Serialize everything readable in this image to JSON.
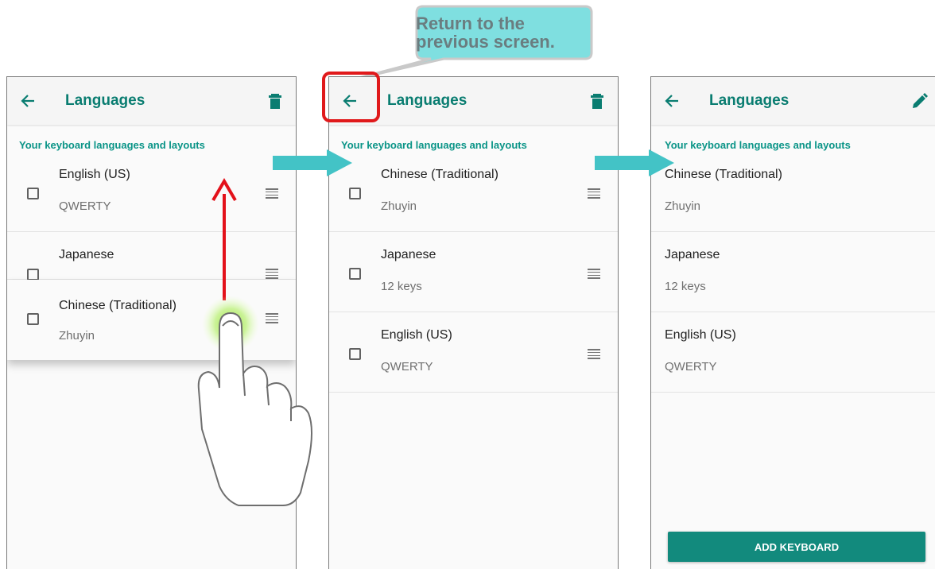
{
  "screens": [
    {
      "title": "Languages",
      "action_icon": "trash-icon",
      "section_label": "Your keyboard languages and layouts",
      "items": [
        {
          "name": "English (US)",
          "sub": "QWERTY"
        },
        {
          "name": "Japanese",
          "sub": ""
        },
        {
          "name": "Chinese (Traditional)",
          "sub": "Zhuyin"
        }
      ]
    },
    {
      "title": "Languages",
      "action_icon": "trash-icon",
      "section_label": "Your keyboard languages and layouts",
      "items": [
        {
          "name": "Chinese (Traditional)",
          "sub": "Zhuyin"
        },
        {
          "name": "Japanese",
          "sub": "12 keys"
        },
        {
          "name": "English (US)",
          "sub": "QWERTY"
        }
      ]
    },
    {
      "title": "Languages",
      "action_icon": "pencil-icon",
      "section_label": "Your keyboard languages and layouts",
      "items": [
        {
          "name": "Chinese (Traditional)",
          "sub": "Zhuyin"
        },
        {
          "name": "Japanese",
          "sub": "12 keys"
        },
        {
          "name": "English (US)",
          "sub": "QWERTY"
        }
      ],
      "button_label": "ADD KEYBOARD"
    }
  ],
  "callout": {
    "line1": "Return to the",
    "line2": "previous screen."
  },
  "colors": {
    "accent": "#0a7d71",
    "button": "#128a7d",
    "arrow": "#43c3c6",
    "highlight": "#e0191b",
    "callout_bg": "#7fdfe0"
  }
}
